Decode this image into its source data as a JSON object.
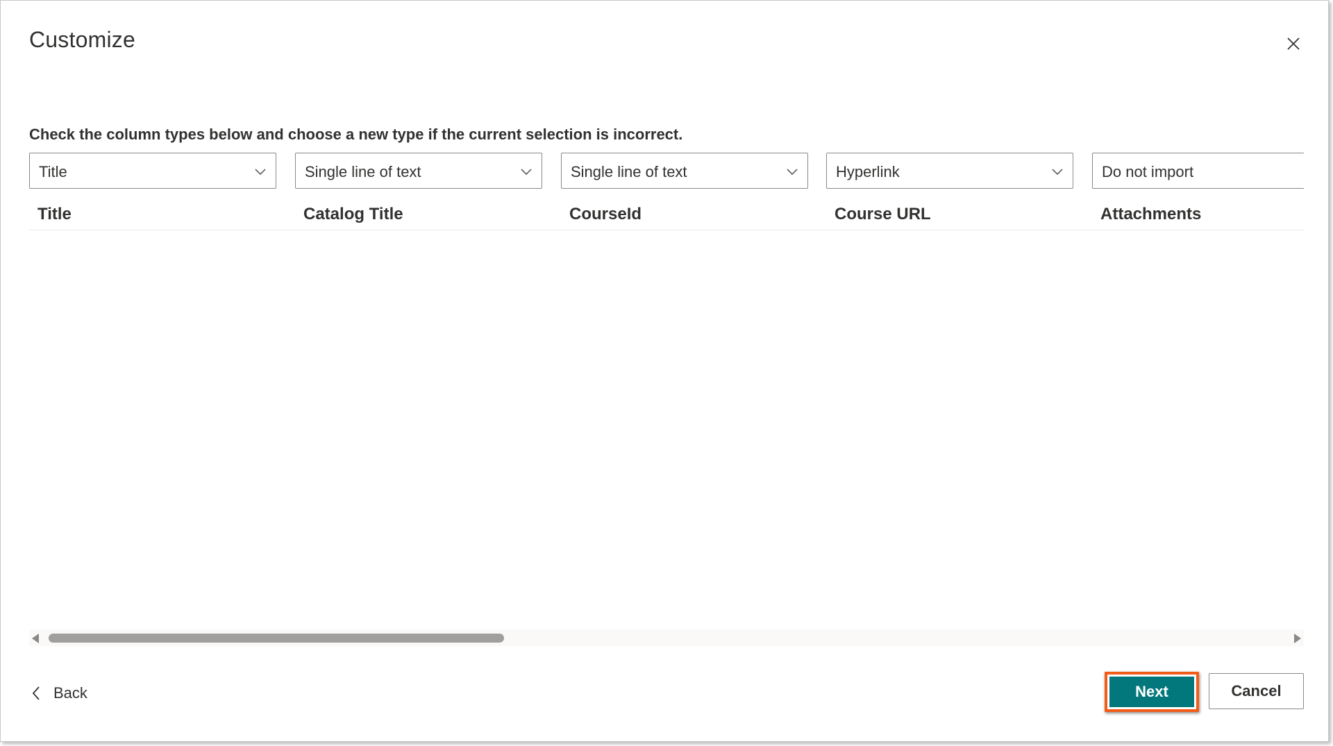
{
  "dialog": {
    "title": "Customize",
    "instructions": "Check the column types below and choose a new type if the current selection is incorrect."
  },
  "columns": [
    {
      "type": "Title",
      "header": "Title"
    },
    {
      "type": "Single line of text",
      "header": "Catalog Title"
    },
    {
      "type": "Single line of text",
      "header": "CourseId"
    },
    {
      "type": "Hyperlink",
      "header": "Course URL"
    },
    {
      "type": "Do not import",
      "header": "Attachments"
    }
  ],
  "footer": {
    "back_label": "Back",
    "next_label": "Next",
    "cancel_label": "Cancel"
  },
  "icons": {
    "close": "close-icon",
    "dropdown": "chevron-down-icon",
    "back": "chevron-left-icon",
    "scroll_left": "scroll-left-arrow-icon",
    "scroll_right": "scroll-right-arrow-icon"
  },
  "colors": {
    "primary": "#03787c",
    "highlight": "#f25c19",
    "text": "#323130",
    "border": "#8a8886"
  }
}
